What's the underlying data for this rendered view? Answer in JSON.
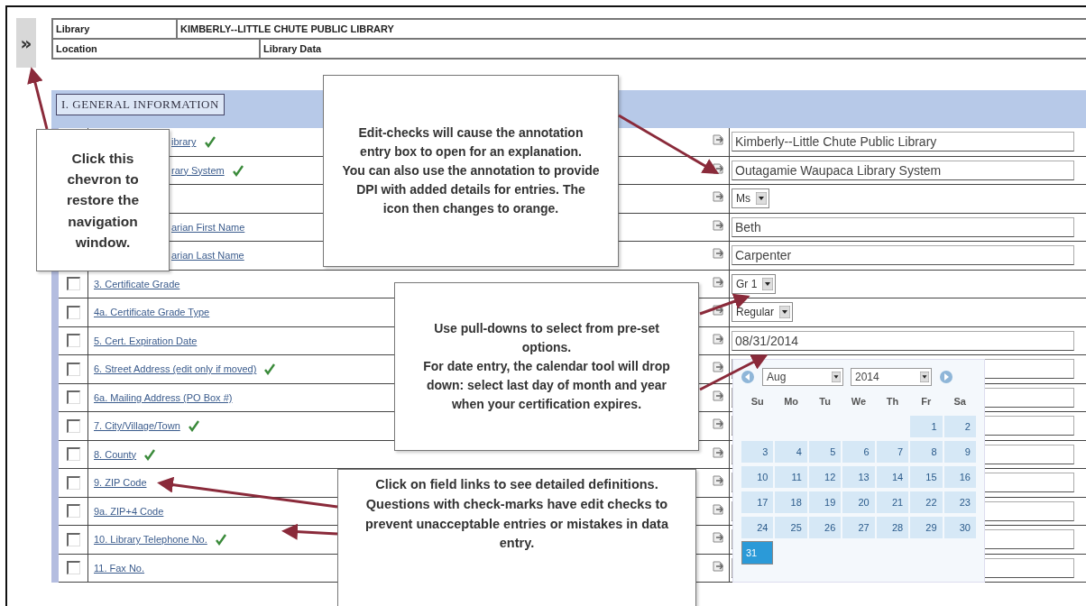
{
  "nav_toggle": {
    "label": "»"
  },
  "header_rows": [
    {
      "label": "Library",
      "value": "KIMBERLY--LITTLE CHUTE PUBLIC LIBRARY"
    },
    {
      "label": "Location",
      "value": "Library Data"
    }
  ],
  "section": {
    "title": "I. GENERAL INFORMATION"
  },
  "rows": [
    {
      "label": "ibrary",
      "covered": true,
      "edit_check": true,
      "kind": "text",
      "value": "Kimberly--Little Chute Public Library"
    },
    {
      "label": "rary System",
      "covered": true,
      "edit_check": true,
      "kind": "text",
      "value": "Outagamie Waupaca Library System"
    },
    {
      "edit_check": false,
      "kind": "select",
      "value": "Ms"
    },
    {
      "label": "arian First Name",
      "covered": true,
      "edit_check": false,
      "kind": "text",
      "value": "Beth"
    },
    {
      "label": "arian Last Name",
      "covered": true,
      "edit_check": false,
      "kind": "text",
      "value": "Carpenter"
    },
    {
      "label": "3. Certificate Grade",
      "covered": false,
      "checked": false,
      "edit_check": false,
      "kind": "select",
      "value": "Gr 1"
    },
    {
      "label": "4a. Certificate Grade Type",
      "covered": false,
      "checked": false,
      "edit_check": false,
      "kind": "select",
      "value": "Regular"
    },
    {
      "label": "5. Cert. Expiration Date",
      "covered": false,
      "checked": false,
      "edit_check": false,
      "kind": "text",
      "value": "08/31/2014"
    },
    {
      "label": "6. Street Address (edit only if moved)",
      "covered": false,
      "checked": false,
      "edit_check": true,
      "kind": "text"
    },
    {
      "label": "6a. Mailing Address (PO Box #)",
      "covered": false,
      "checked": false,
      "edit_check": false,
      "kind": "text"
    },
    {
      "label": "7. City/Village/Town",
      "covered": false,
      "checked": false,
      "edit_check": true,
      "kind": "text"
    },
    {
      "label": "8. County",
      "covered": false,
      "checked": false,
      "edit_check": true,
      "kind": "text"
    },
    {
      "label": "9. ZIP Code",
      "covered": false,
      "checked": false,
      "edit_check": false,
      "kind": "text"
    },
    {
      "label": "9a. ZIP+4 Code",
      "covered": false,
      "checked": false,
      "edit_check": false,
      "kind": "text"
    },
    {
      "label": "10. Library Telephone No.",
      "covered": false,
      "checked": false,
      "edit_check": true,
      "kind": "text"
    },
    {
      "label": "11. Fax No.",
      "covered": false,
      "checked": false,
      "edit_check": false,
      "kind": "text"
    }
  ],
  "calendar": {
    "month": "Aug",
    "year": "2014",
    "weekdays": [
      "Su",
      "Mo",
      "Tu",
      "We",
      "Th",
      "Fr",
      "Sa"
    ],
    "weeks": [
      [
        {
          "day": "1",
          "selected": false
        },
        {
          "day": "2",
          "selected": false
        }
      ],
      [
        {
          "day": "3",
          "selected": false
        },
        {
          "day": "4",
          "selected": false
        },
        {
          "day": "5",
          "selected": false
        },
        {
          "day": "6",
          "selected": false
        },
        {
          "day": "7",
          "selected": false
        },
        {
          "day": "8",
          "selected": false
        },
        {
          "day": "9",
          "selected": false
        }
      ],
      [
        {
          "day": "10",
          "selected": false
        },
        {
          "day": "11",
          "selected": false
        },
        {
          "day": "12",
          "selected": false
        },
        {
          "day": "13",
          "selected": false
        },
        {
          "day": "14",
          "selected": false
        },
        {
          "day": "15",
          "selected": false
        },
        {
          "day": "16",
          "selected": false
        }
      ],
      [
        {
          "day": "17",
          "selected": false
        },
        {
          "day": "18",
          "selected": false
        },
        {
          "day": "19",
          "selected": false
        },
        {
          "day": "20",
          "selected": false
        },
        {
          "day": "21",
          "selected": false
        },
        {
          "day": "22",
          "selected": false
        },
        {
          "day": "23",
          "selected": false
        }
      ],
      [
        {
          "day": "24",
          "selected": false
        },
        {
          "day": "25",
          "selected": false
        },
        {
          "day": "26",
          "selected": false
        },
        {
          "day": "27",
          "selected": false
        },
        {
          "day": "28",
          "selected": false
        },
        {
          "day": "29",
          "selected": false
        },
        {
          "day": "30",
          "selected": false
        }
      ],
      [
        {
          "day": "31",
          "selected": true
        }
      ]
    ]
  },
  "callouts": [
    {
      "paragraphs": [
        "Click this chevron to restore the navigation window."
      ]
    },
    {
      "paragraphs": [
        "Edit-checks will cause the annotation entry box to open for an explanation.",
        "You can also use the annotation to provide DPI with added details for entries. The icon then changes to orange."
      ]
    },
    {
      "paragraphs": [
        "Use pull-downs to select from pre-set options.",
        "For date entry, the calendar tool will drop down:  select last day of month and year when your certification expires."
      ]
    },
    {
      "paragraphs": [
        "Click on field links to see detailed definitions.",
        "Questions with check-marks have edit checks to prevent unacceptable entries or mistakes in data entry."
      ]
    }
  ]
}
